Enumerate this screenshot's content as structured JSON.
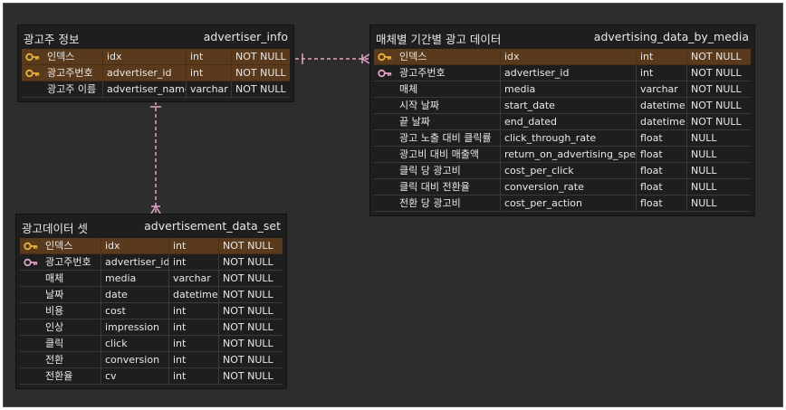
{
  "tables": [
    {
      "name": "광고주 정보",
      "id": "advertiser_info",
      "rows": [
        {
          "key": "primary",
          "label": "인덱스",
          "field": "idx",
          "type": "int",
          "null": "NOT NULL"
        },
        {
          "key": "primary",
          "label": "광고주번호",
          "field": "advertiser_id",
          "type": "int",
          "null": "NOT NULL"
        },
        {
          "key": "",
          "label": "광고주 이름",
          "field": "advertiser_name",
          "type": "varchar",
          "null": "NOT NULL"
        }
      ]
    },
    {
      "name": "매체별 기간별 광고 데이터",
      "id": "advertising_data_by_media",
      "rows": [
        {
          "key": "primary",
          "label": "인덱스",
          "field": "idx",
          "type": "int",
          "null": "NOT NULL"
        },
        {
          "key": "foreign",
          "label": "광고주번호",
          "field": "advertiser_id",
          "type": "int",
          "null": "NOT NULL"
        },
        {
          "key": "",
          "label": "매체",
          "field": "media",
          "type": "varchar",
          "null": "NOT NULL"
        },
        {
          "key": "",
          "label": "시작 날짜",
          "field": "start_date",
          "type": "datetime",
          "null": "NOT NULL"
        },
        {
          "key": "",
          "label": "끝 날짜",
          "field": "end_dated",
          "type": "datetime",
          "null": "NOT NULL"
        },
        {
          "key": "",
          "label": "광고 노출 대비 클릭률",
          "field": "click_through_rate",
          "type": "float",
          "null": "NULL"
        },
        {
          "key": "",
          "label": "광고비 대비 매출액",
          "field": "return_on_advertising_spend",
          "type": "float",
          "null": "NULL"
        },
        {
          "key": "",
          "label": "클릭 당 광고비",
          "field": "cost_per_click",
          "type": "float",
          "null": "NULL"
        },
        {
          "key": "",
          "label": "클릭 대비 전환율",
          "field": "conversion_rate",
          "type": "float",
          "null": "NULL"
        },
        {
          "key": "",
          "label": "전환 당 광고비",
          "field": "cost_per_action",
          "type": "float",
          "null": "NULL"
        }
      ]
    },
    {
      "name": "광고데이터 셋",
      "id": "advertisement_data_set",
      "rows": [
        {
          "key": "primary",
          "label": "인덱스",
          "field": "idx",
          "type": "int",
          "null": "NOT NULL"
        },
        {
          "key": "foreign",
          "label": "광고주번호",
          "field": "advertiser_id",
          "type": "int",
          "null": "NOT NULL"
        },
        {
          "key": "",
          "label": "매체",
          "field": "media",
          "type": "varchar",
          "null": "NOT NULL"
        },
        {
          "key": "",
          "label": "날짜",
          "field": "date",
          "type": "datetime",
          "null": "NOT NULL"
        },
        {
          "key": "",
          "label": "비용",
          "field": "cost",
          "type": "int",
          "null": "NOT NULL"
        },
        {
          "key": "",
          "label": "인상",
          "field": "impression",
          "type": "int",
          "null": "NOT NULL"
        },
        {
          "key": "",
          "label": "클릭",
          "field": "click",
          "type": "int",
          "null": "NOT NULL"
        },
        {
          "key": "",
          "label": "전환",
          "field": "conversion",
          "type": "int",
          "null": "NOT NULL"
        },
        {
          "key": "",
          "label": "전환율",
          "field": "cv",
          "type": "int",
          "null": "NOT NULL"
        }
      ]
    }
  ],
  "colors": {
    "canvas": "#2d2d2d",
    "table": "#1e1e1e",
    "pk_row": "#5a3a1c",
    "primary_key_icon": "#e8b23a",
    "foreign_key_icon": "#e0a0c8",
    "relation_line": "#e6a3c6"
  },
  "icons": {
    "primary": "key-icon",
    "foreign": "foreign-key-icon"
  }
}
